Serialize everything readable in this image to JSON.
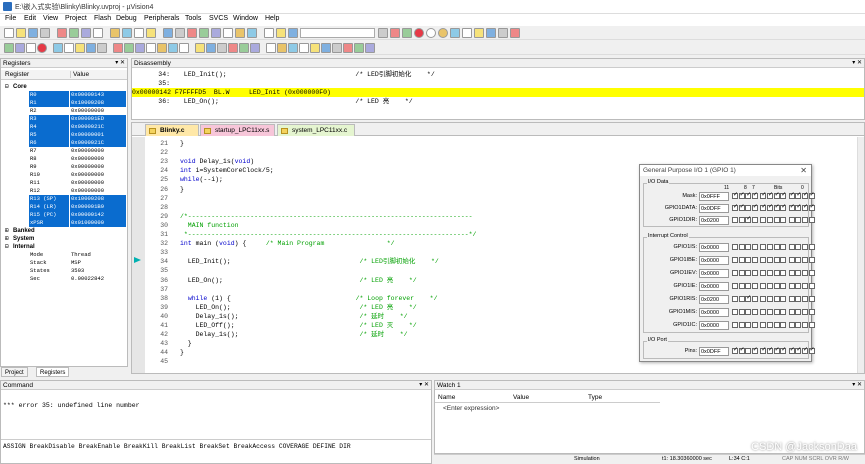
{
  "window": {
    "title": "E:\\嵌入式实验\\Blinky\\Blinky.uvproj - µVision4"
  },
  "menu": [
    "File",
    "Edit",
    "View",
    "Project",
    "Flash",
    "Debug",
    "Peripherals",
    "Tools",
    "SVCS",
    "Window",
    "Help"
  ],
  "registers": {
    "title": "Registers",
    "col_register": "Register",
    "col_value": "Value",
    "group_core": "Core",
    "rows": [
      {
        "name": "R0",
        "value": "0x00000143",
        "hl": true
      },
      {
        "name": "R1",
        "value": "0x10000208",
        "hl": true
      },
      {
        "name": "R2",
        "value": "0x00000000",
        "hl": false
      },
      {
        "name": "R3",
        "value": "0x000001ED",
        "hl": true
      },
      {
        "name": "R4",
        "value": "0x0000021C",
        "hl": true
      },
      {
        "name": "R5",
        "value": "0x00000001",
        "hl": true
      },
      {
        "name": "R6",
        "value": "0x0000021C",
        "hl": true
      },
      {
        "name": "R7",
        "value": "0x00000000",
        "hl": false
      },
      {
        "name": "R8",
        "value": "0x00000000",
        "hl": false
      },
      {
        "name": "R9",
        "value": "0x00000000",
        "hl": false
      },
      {
        "name": "R10",
        "value": "0x00000000",
        "hl": false
      },
      {
        "name": "R11",
        "value": "0x00000000",
        "hl": false
      },
      {
        "name": "R12",
        "value": "0x00000000",
        "hl": false
      },
      {
        "name": "R13 (SP)",
        "value": "0x10000208",
        "hl": true
      },
      {
        "name": "R14 (LR)",
        "value": "0x000001B9",
        "hl": true
      },
      {
        "name": "R15 (PC)",
        "value": "0x00000142",
        "hl": true
      },
      {
        "name": "xPSR",
        "value": "0x01000000",
        "hl": true
      }
    ],
    "group_banked": "Banked",
    "group_system": "System",
    "group_internal": "Internal",
    "internal": [
      {
        "name": "Mode",
        "value": "Thread"
      },
      {
        "name": "Stack",
        "value": "MSP"
      },
      {
        "name": "States",
        "value": "3503"
      },
      {
        "name": "Sec",
        "value": "0.00022842"
      }
    ],
    "tab_project": "Project",
    "tab_registers": "Registers"
  },
  "disassembly": {
    "title": "Disassembly",
    "lines": [
      {
        "ln": "34:",
        "text": "  LED_Init();                                 /* LED引脚初始化    */"
      },
      {
        "ln": "35:",
        "text": ""
      },
      {
        "ln": "",
        "text": "0x00000142 F7FFFFD5  BL.W     LED_Init (0x000000F0)",
        "current": true
      },
      {
        "ln": "36:",
        "text": "  LED_On();                                   /* LED 亮    */"
      }
    ]
  },
  "editor": {
    "tabs": [
      "Blinky.c",
      "startup_LPC11xx.s",
      "system_LPC11xx.c"
    ],
    "lines": [
      {
        "ln": "21",
        "html": "}"
      },
      {
        "ln": "22",
        "html": ""
      },
      {
        "ln": "23",
        "html": "<span class='kw'>void</span> Delay_1s(<span class='kw'>void</span>)"
      },
      {
        "ln": "24",
        "html": "<span class='kw'>int</span> i=SystemCoreClock/5;"
      },
      {
        "ln": "25",
        "html": "<span class='kw'>while</span>(--i);"
      },
      {
        "ln": "26",
        "html": "}"
      },
      {
        "ln": "27",
        "html": ""
      },
      {
        "ln": "28",
        "html": ""
      },
      {
        "ln": "29",
        "html": "<span class='cm'>/*-------------------------------------------------------------------------</span>"
      },
      {
        "ln": "30",
        "html": "<span class='cm'>  MAIN function</span>"
      },
      {
        "ln": "31",
        "html": "<span class='cm'> *------------------------------------------------------------------------*/</span>"
      },
      {
        "ln": "32",
        "html": "<span class='kw'>int</span> main (<span class='kw'>void</span>) {     <span class='cm'>/* Main Program                */</span>"
      },
      {
        "ln": "33",
        "html": ""
      },
      {
        "ln": "34",
        "html": "  LED_Init();                                 <span class='cm'>/* LED引脚初始化    */</span>",
        "marker": true
      },
      {
        "ln": "35",
        "html": ""
      },
      {
        "ln": "36",
        "html": "  LED_On();                                   <span class='cm'>/* LED 亮    */</span>"
      },
      {
        "ln": "37",
        "html": ""
      },
      {
        "ln": "38",
        "html": "  <span class='kw'>while</span> (1) {                                <span class='cm'>/* Loop forever    */</span>"
      },
      {
        "ln": "39",
        "html": "    LED_On();                                 <span class='cm'>/* LED 亮    */</span>"
      },
      {
        "ln": "40",
        "html": "    Delay_1s();                               <span class='cm'>/* 延时    */</span>"
      },
      {
        "ln": "41",
        "html": "    LED_Off();                                <span class='cm'>/* LED 灭    */</span>"
      },
      {
        "ln": "42",
        "html": "    Delay_1s();                               <span class='cm'>/* 延时    */</span>"
      },
      {
        "ln": "43",
        "html": "  }"
      },
      {
        "ln": "44",
        "html": "}"
      },
      {
        "ln": "45",
        "html": ""
      }
    ]
  },
  "gpio": {
    "title": "General Purpose I/O 1 (GPIO 1)",
    "io_data": "I/O Data",
    "hdr_11": "11",
    "hdr_8": "8",
    "hdr_7": "7",
    "hdr_bits": "Bits",
    "hdr_0": "0",
    "mask_label": "Mask:",
    "mask_value": "0x0FFF",
    "data_label": "GPIO1DATA:",
    "data_value": "0x0DFF",
    "dir_label": "GPIO1DIR:",
    "dir_value": "0x0200",
    "interrupt": "Interrupt Control",
    "irows": [
      {
        "label": "GPIO1IS:",
        "value": "0x0000"
      },
      {
        "label": "GPIO1IBE:",
        "value": "0x0000"
      },
      {
        "label": "GPIO1IEV:",
        "value": "0x0000"
      },
      {
        "label": "GPIO1IE:",
        "value": "0x0000"
      },
      {
        "label": "GPIO1RIS:",
        "value": "0x0200"
      },
      {
        "label": "GPIO1MIS:",
        "value": "0x0000"
      },
      {
        "label": "GPIO1IC:",
        "value": "0x0000"
      }
    ],
    "ioport": "I/O Port",
    "pins_label": "Pins:",
    "pins_value": "0x0DFF"
  },
  "command": {
    "title": "Command",
    "error": "*** error 35: undefined line number",
    "hint": "ASSIGN BreakDisable BreakEnable BreakKill BreakList BreakSet BreakAccess COVERAGE DEFINE DIR"
  },
  "watch": {
    "title": "Watch 1",
    "col_name": "Name",
    "col_value": "Value",
    "col_type": "Type",
    "placeholder": "<Enter expression>"
  },
  "status": {
    "mode": "Simulation",
    "time": "t1: 18.30360000 sec",
    "pos": "L:34 C:1",
    "flags": "CAP  NUM  SCRL  OVR  R/W"
  },
  "watermark": "CSDN @JacksonDaa"
}
